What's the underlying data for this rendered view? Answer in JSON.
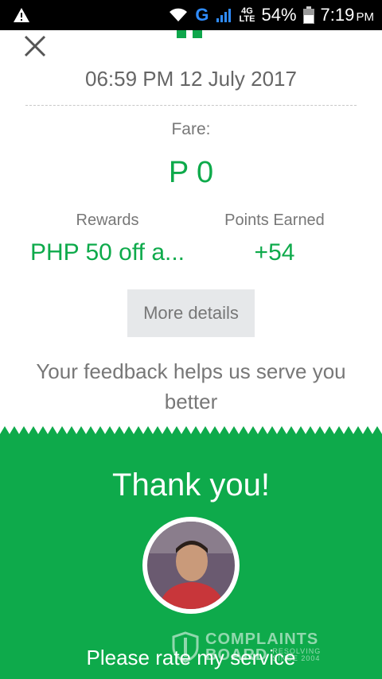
{
  "status_bar": {
    "network": "G",
    "network_type_top": "4G",
    "network_type_bottom": "LTE",
    "battery_percent": "54%",
    "time": "7:19",
    "time_period": "PM"
  },
  "receipt": {
    "datetime": "06:59 PM 12 July 2017",
    "fare_label": "Fare:",
    "fare_value": "P 0",
    "rewards_label": "Rewards",
    "rewards_value": "PHP 50 off a...",
    "points_label": "Points Earned",
    "points_value": "+54",
    "more_details_label": "More details",
    "feedback_text": "Your feedback helps us serve you better"
  },
  "rating": {
    "thank_you": "Thank you!",
    "prompt": "Please rate my service"
  },
  "watermark": {
    "line1": "COMPLAINTS",
    "line2": "BOARD",
    "tag1": "RESOLVING",
    "tag2": "SINCE 2004"
  },
  "colors": {
    "brand_green": "#0eaa4b",
    "text_gray": "#777777",
    "button_bg": "#e6e8ea"
  },
  "icons": [
    "warning-icon",
    "wifi-icon",
    "signal-icon",
    "battery-icon",
    "close-icon",
    "avatar-photo"
  ]
}
